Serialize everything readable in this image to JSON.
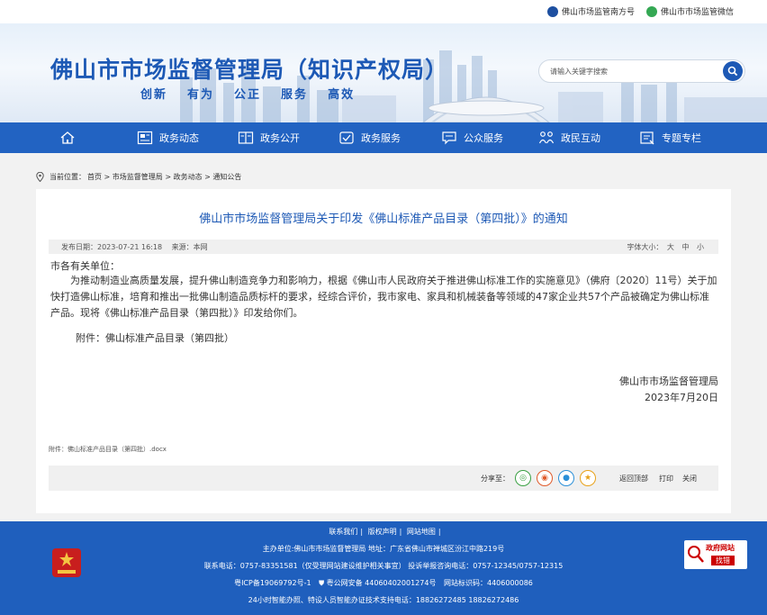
{
  "top_links": {
    "south_account": "佛山市场监管南方号",
    "wechat": "佛山市市场监管微信"
  },
  "header": {
    "site_title": "佛山市市场监督管理局（知识产权局）",
    "slogans": [
      "创新",
      "有为",
      "公正",
      "服务",
      "高效"
    ],
    "search_placeholder": "请输入关键字搜索"
  },
  "nav": {
    "items": [
      {
        "label": "",
        "icon": "home-icon"
      },
      {
        "label": "政务动态",
        "icon": "news-icon"
      },
      {
        "label": "政务公开",
        "icon": "open-book-icon"
      },
      {
        "label": "政务服务",
        "icon": "service-icon"
      },
      {
        "label": "公众服务",
        "icon": "chat-icon"
      },
      {
        "label": "政民互动",
        "icon": "people-icon"
      },
      {
        "label": "专题专栏",
        "icon": "topic-icon"
      }
    ]
  },
  "breadcrumb": {
    "prefix": "当前位置：",
    "path": "首页 > 市场监督管理局 > 政务动态 > 通知公告"
  },
  "article": {
    "title": "佛山市市场监督管理局关于印发《佛山标准产品目录（第四批）》的通知",
    "publish_date": "发布日期：2023-07-21 16:18",
    "source": "来源：本网",
    "font_size_label": "字体大小：",
    "font_sizes": [
      "大",
      "中",
      "小"
    ],
    "salutation": "市各有关单位：",
    "paragraph": "为推动制造业高质量发展，提升佛山制造竞争力和影响力，根据《佛山市人民政府关于推进佛山标准工作的实施意见》（佛府〔2020〕11号）关于加快打造佛山标准，培育和推出一批佛山制造品质标杆的要求，经综合评价，我市家电、家具和机械装备等领域的47家企业共57个产品被确定为佛山标准产品。现将《佛山标准产品目录（第四批）》印发给你们。",
    "attachment_line": "附件：佛山标准产品目录（第四批）",
    "signature_org": "佛山市市场监督管理局",
    "signature_date": "2023年7月20日",
    "attachment_file": "附件：佛山标准产品目录（第四批）.docx"
  },
  "share": {
    "label": "分享至：",
    "back_top": "返回顶部",
    "print": "打印",
    "close": "关闭"
  },
  "footer": {
    "links": [
      "联系我们",
      "版权声明",
      "网站地图"
    ],
    "host": "主办单位:佛山市市场监督管理局  地址：广东省佛山市禅城区汾江中路219号",
    "phone": "联系电话：0757-83351581（仅受理网站建设维护相关事宜）  投诉举报咨询电话：0757-12345/0757-12315",
    "icp": "粤ICP备19069792号-1",
    "police": "粤公网安备 44060402001274号",
    "site_code": "网站标识码：4406000086",
    "support": "24小时智能办照、特设人员智能办证技术支持电话：18826272485 18826272486",
    "badge_title": "政府网站",
    "badge_action": "找错"
  },
  "colors": {
    "brand_blue": "#1d59b5",
    "nav_blue": "#2263c2",
    "footer_blue": "#1f5fbd",
    "badge_red": "#cc0000"
  }
}
